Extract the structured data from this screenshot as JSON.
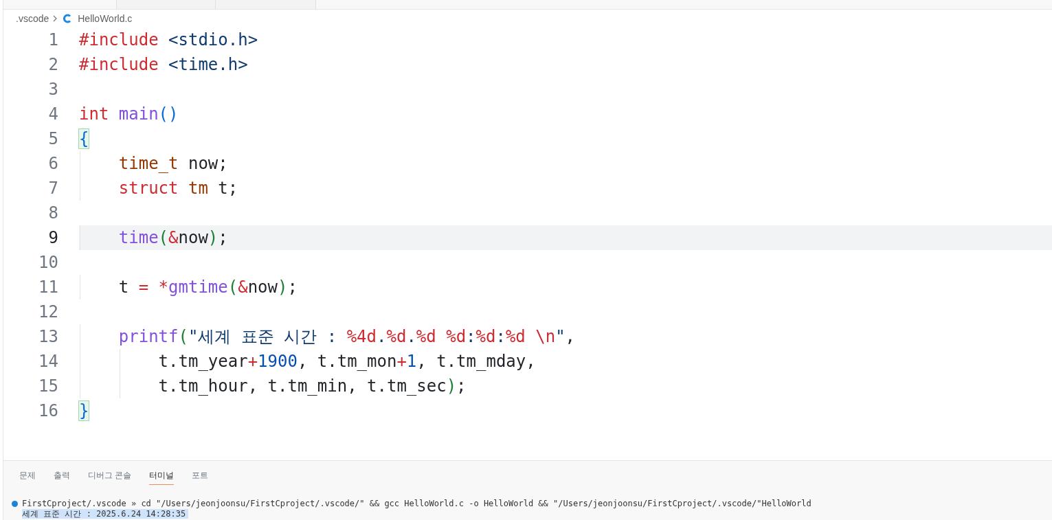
{
  "breadcrumb": {
    "folder": ".vscode",
    "file": "HelloWorld.c"
  },
  "editor": {
    "lines": [
      {
        "number": "1",
        "current": false,
        "tokens": [
          {
            "kind": "directive",
            "text": "#include "
          },
          {
            "kind": "header",
            "text": "<stdio.h>"
          }
        ]
      },
      {
        "number": "2",
        "current": false,
        "tokens": [
          {
            "kind": "directive",
            "text": "#include "
          },
          {
            "kind": "header",
            "text": "<time.h>"
          }
        ]
      },
      {
        "number": "3",
        "current": false
      },
      {
        "number": "4",
        "current": false,
        "tokens": [
          {
            "kind": "keyword",
            "text": "int "
          },
          {
            "kind": "function",
            "text": "main"
          },
          {
            "kind": "bracket1",
            "text": "()"
          }
        ]
      },
      {
        "number": "5",
        "current": false,
        "tokens": [
          {
            "kind": "bracket_match",
            "text": "{"
          }
        ]
      },
      {
        "number": "6",
        "current": false,
        "tokens": [
          {
            "kind": "type",
            "text": "    time_t"
          },
          {
            "kind": "plain",
            "text": " now;"
          }
        ]
      },
      {
        "number": "7",
        "current": false,
        "tokens": [
          {
            "kind": "keyword",
            "text": "    struct "
          },
          {
            "kind": "type",
            "text": "tm"
          },
          {
            "kind": "plain",
            "text": " t;"
          }
        ]
      },
      {
        "number": "8",
        "current": false
      },
      {
        "number": "9",
        "current": true,
        "tokens": [
          {
            "kind": "function",
            "text": "    time"
          },
          {
            "kind": "bracket2",
            "text": "("
          },
          {
            "kind": "operator",
            "text": "&"
          },
          {
            "kind": "plain",
            "text": "now"
          },
          {
            "kind": "bracket2",
            "text": ")"
          },
          {
            "kind": "plain",
            "text": ";"
          }
        ]
      },
      {
        "number": "10",
        "current": false
      },
      {
        "number": "11",
        "current": false,
        "tokens": [
          {
            "kind": "plain",
            "text": "    t "
          },
          {
            "kind": "operator",
            "text": "= *"
          },
          {
            "kind": "function",
            "text": "gmtime"
          },
          {
            "kind": "bracket2",
            "text": "("
          },
          {
            "kind": "operator",
            "text": "&"
          },
          {
            "kind": "plain",
            "text": "now"
          },
          {
            "kind": "bracket2",
            "text": ")"
          },
          {
            "kind": "plain",
            "text": ";"
          }
        ]
      },
      {
        "number": "12",
        "current": false
      },
      {
        "number": "13",
        "current": false,
        "tokens": [
          {
            "kind": "function",
            "text": "    printf"
          },
          {
            "kind": "bracket2",
            "text": "("
          },
          {
            "kind": "string",
            "text": "\"세계 표준 시간 : "
          },
          {
            "kind": "escape",
            "text": "%4d"
          },
          {
            "kind": "string",
            "text": "."
          },
          {
            "kind": "escape",
            "text": "%d"
          },
          {
            "kind": "string",
            "text": "."
          },
          {
            "kind": "escape",
            "text": "%d %d"
          },
          {
            "kind": "string",
            "text": ":"
          },
          {
            "kind": "escape",
            "text": "%d"
          },
          {
            "kind": "string",
            "text": ":"
          },
          {
            "kind": "escape",
            "text": "%d \\n"
          },
          {
            "kind": "string",
            "text": "\""
          },
          {
            "kind": "plain",
            "text": ","
          }
        ]
      },
      {
        "number": "14",
        "current": false,
        "tokens": [
          {
            "kind": "plain",
            "text": "        t.tm_year"
          },
          {
            "kind": "operator",
            "text": "+"
          },
          {
            "kind": "number",
            "text": "1900"
          },
          {
            "kind": "plain",
            "text": ", t.tm_mon"
          },
          {
            "kind": "operator",
            "text": "+"
          },
          {
            "kind": "number",
            "text": "1"
          },
          {
            "kind": "plain",
            "text": ", t.tm_mday,"
          }
        ]
      },
      {
        "number": "15",
        "current": false,
        "tokens": [
          {
            "kind": "plain",
            "text": "        t.tm_hour, t.tm_min, t.tm_sec"
          },
          {
            "kind": "bracket2",
            "text": ")"
          },
          {
            "kind": "plain",
            "text": ";"
          }
        ]
      },
      {
        "number": "16",
        "current": false,
        "tokens": [
          {
            "kind": "bracket_match",
            "text": "}"
          }
        ]
      }
    ]
  },
  "panel": {
    "tabs": [
      {
        "label": "문제",
        "selected": false
      },
      {
        "label": "출력",
        "selected": false
      },
      {
        "label": "디버그 콘솔",
        "selected": false
      },
      {
        "label": "터미널",
        "selected": true
      },
      {
        "label": "포트",
        "selected": false
      }
    ],
    "terminal": {
      "prompt": "FirstCproject/.vscode » cd \"/Users/jeonjoonsu/FirstCproject/.vscode/\" && gcc HelloWorld.c -o HelloWorld && \"/Users/jeonjoonsu/FirstCproject/.vscode/\"HelloWorld",
      "output": "세계 표준 시간 : 2025.6.24 14:28:35"
    }
  }
}
